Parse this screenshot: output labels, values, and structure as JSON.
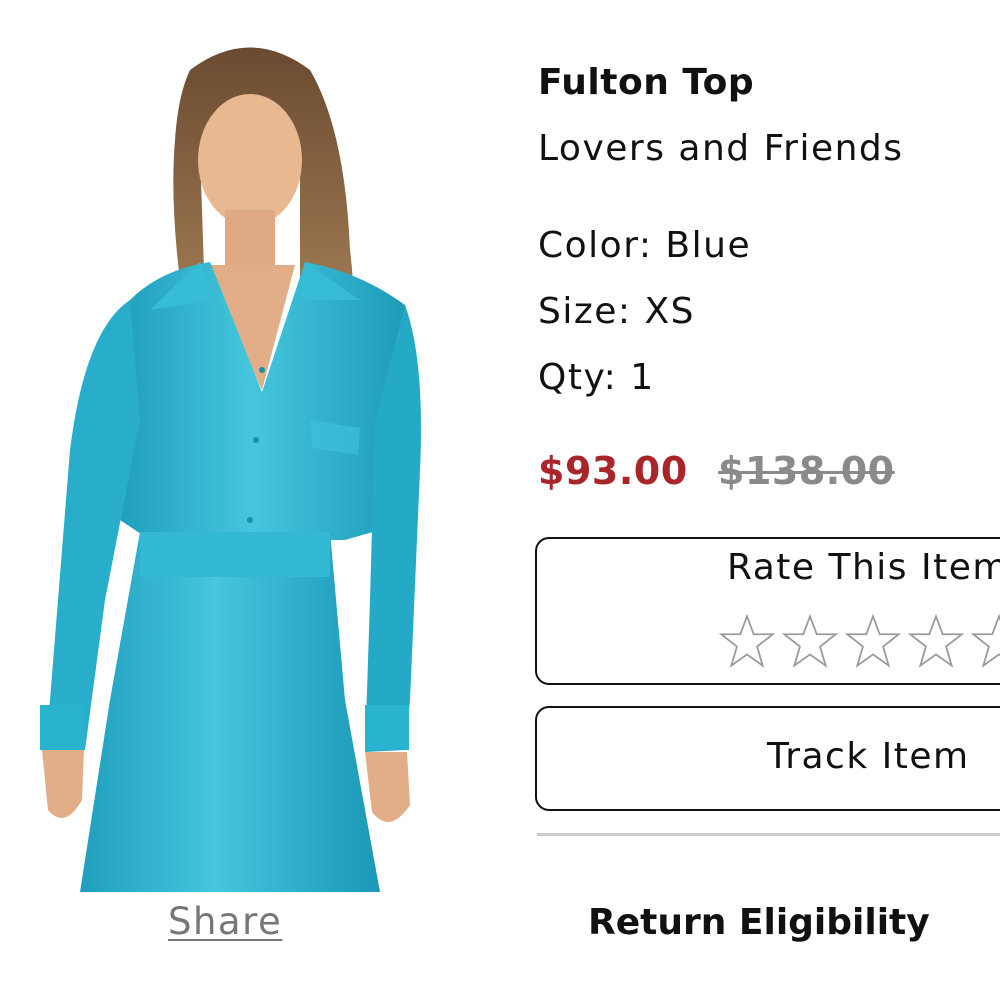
{
  "product": {
    "title": "Fulton Top",
    "brand": "Lovers and Friends",
    "color_line": "Color: Blue",
    "size_line": "Size: XS",
    "qty_line": "Qty: 1",
    "sale_price": "$93.00",
    "original_price": "$138.00"
  },
  "rating": {
    "label": "Rate This Item",
    "max_stars": 5,
    "current": 0
  },
  "actions": {
    "track_label": "Track Item",
    "share_label": "Share",
    "return_label": "Return Eligibility"
  },
  "colors": {
    "sale_price": "#a8262a",
    "original_price": "#8a8a8a",
    "garment": "#2eb4cf",
    "divider": "#cccccc"
  }
}
